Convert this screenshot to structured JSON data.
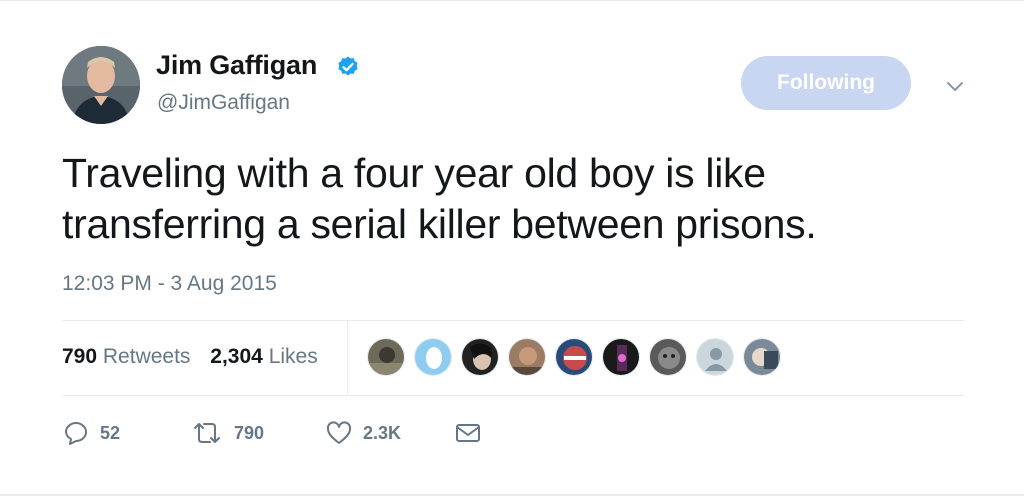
{
  "author": {
    "name": "Jim Gaffigan",
    "handle": "@JimGaffigan",
    "verified": true
  },
  "follow_button": {
    "label": "Following",
    "color": "#c8d6f2"
  },
  "tweet": {
    "line1": "Traveling with a four year old boy is like",
    "line2": "transferring a serial killer between prisons."
  },
  "timestamp": "12:03 PM - 3 Aug 2015",
  "stats": {
    "retweets_count": "790",
    "retweets_label": "Retweets",
    "likes_count": "2,304",
    "likes_label": "Likes"
  },
  "likers_count": 9,
  "actions": {
    "replies": "52",
    "retweets": "790",
    "likes": "2.3K"
  },
  "colors": {
    "text": "#14171a",
    "secondary": "#657786",
    "verified": "#1da1f2",
    "divider": "#e6ecf0"
  }
}
